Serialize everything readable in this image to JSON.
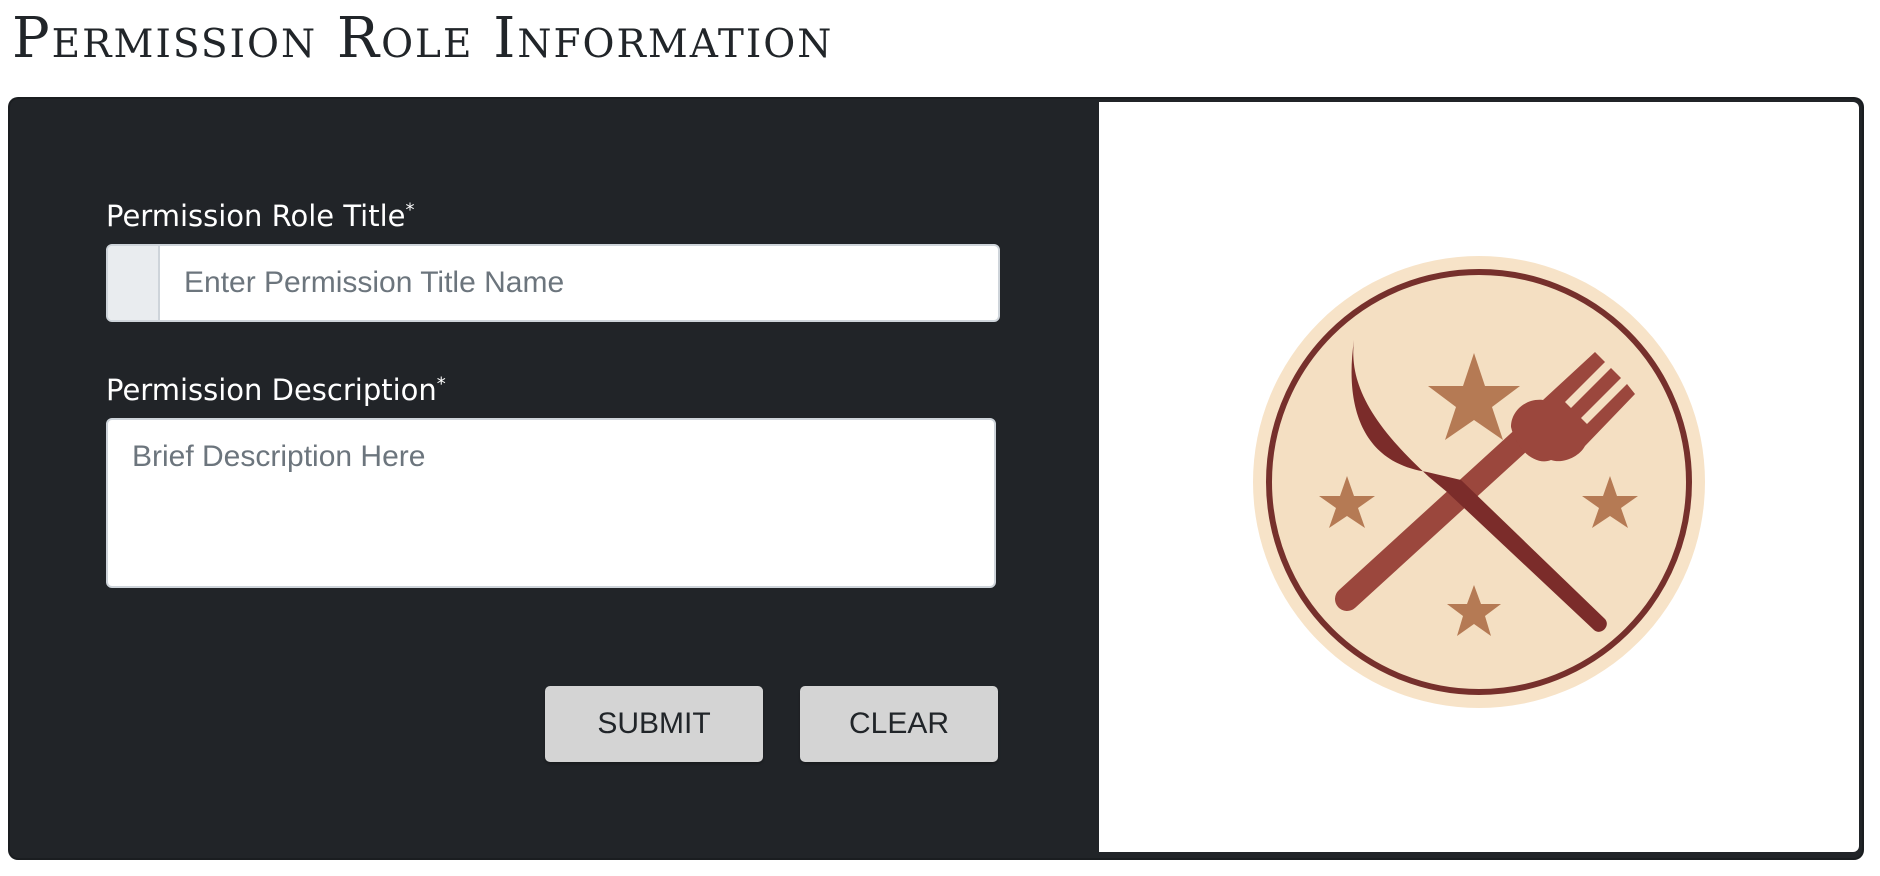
{
  "page": {
    "title": "Permission Role Information"
  },
  "form": {
    "title_label": "Permission Role Title",
    "title_required_mark": "*",
    "title_placeholder": "Enter Permission Title Name",
    "title_value": "",
    "description_label": "Permission Description",
    "description_required_mark": "*",
    "description_placeholder": "Brief Description Here",
    "description_value": "",
    "submit_label": "SUBMIT",
    "clear_label": "CLEAR"
  },
  "logo": {
    "icon": "crossed-knife-fork-stars-icon",
    "colors": {
      "outer": "#f7e3c8",
      "ring": "#76302c",
      "inner": "#f4dfc2",
      "star": "#b57a54",
      "knife": "#7b2c2a",
      "fork": "#9b473d"
    }
  },
  "colors": {
    "panel_background": "#212428",
    "button_background": "#d4d4d4",
    "label_text": "#ffffff"
  }
}
